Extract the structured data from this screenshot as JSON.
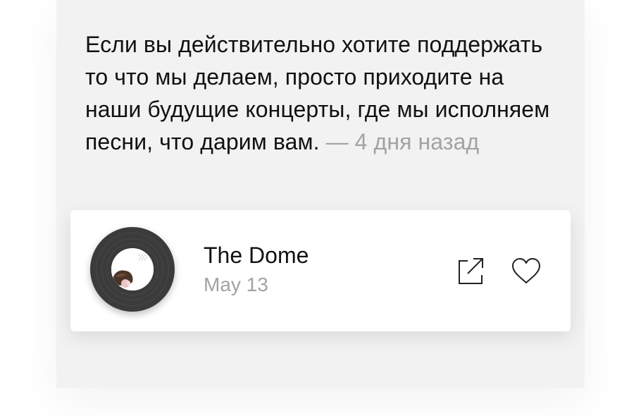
{
  "comment": {
    "text": "Если вы действительно хотите поддержать то что мы делаем, просто приходите на наши будущие концерты, где мы исполняем песни, что дарим вам.",
    "timestamp": "— 4 дня назад"
  },
  "track": {
    "title": "The Dome",
    "date": "May 13",
    "cover_icon": "vinyl-record-icon",
    "actions": [
      {
        "icon": "share-icon"
      },
      {
        "icon": "heart-icon"
      }
    ]
  },
  "colors": {
    "panel_background": "#f2f2f2",
    "card_background": "#ffffff",
    "primary_text": "#111111",
    "secondary_text": "#a3a3a3",
    "vinyl": "#3b3b3b"
  }
}
